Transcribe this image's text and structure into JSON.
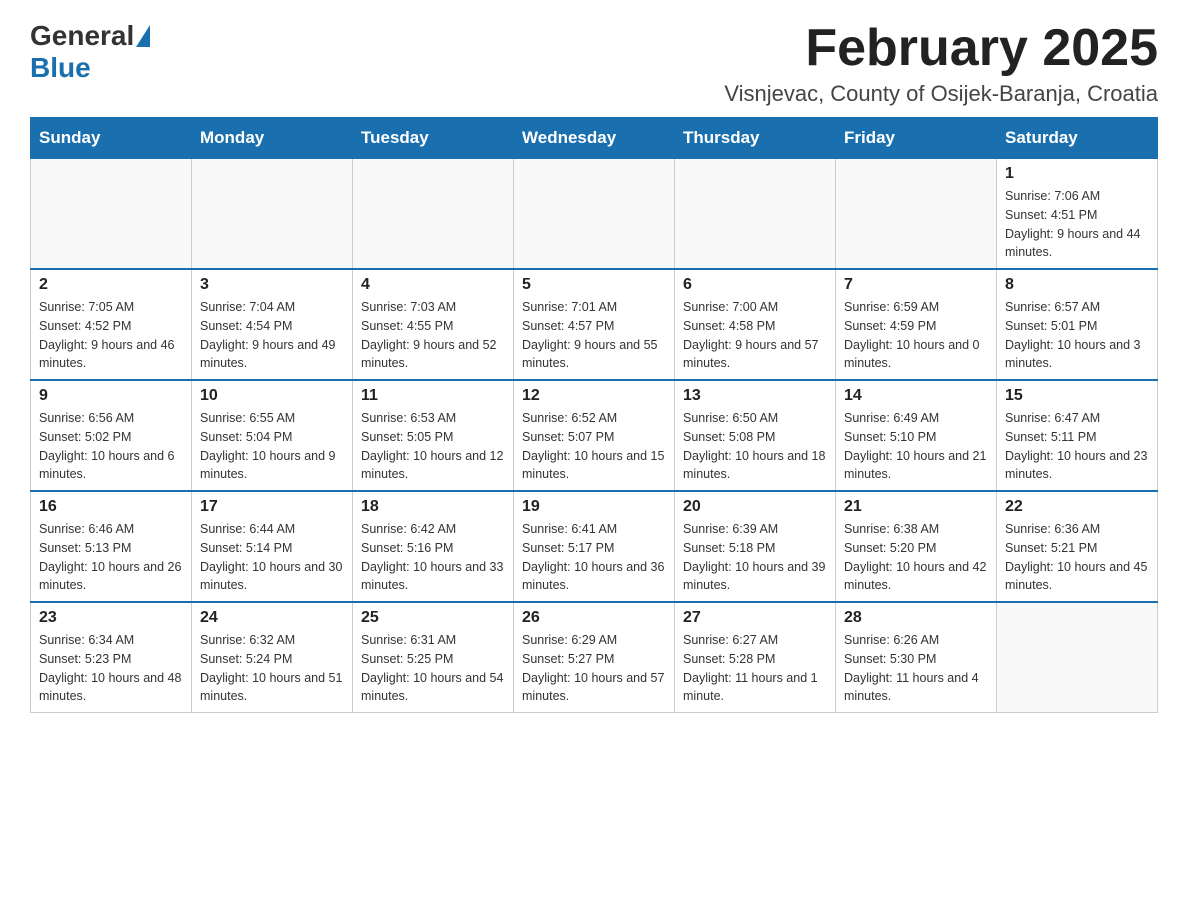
{
  "logo": {
    "text_general": "General",
    "text_blue": "Blue"
  },
  "header": {
    "title": "February 2025",
    "subtitle": "Visnjevac, County of Osijek-Baranja, Croatia"
  },
  "weekdays": [
    "Sunday",
    "Monday",
    "Tuesday",
    "Wednesday",
    "Thursday",
    "Friday",
    "Saturday"
  ],
  "weeks": [
    [
      {
        "day": "",
        "info": ""
      },
      {
        "day": "",
        "info": ""
      },
      {
        "day": "",
        "info": ""
      },
      {
        "day": "",
        "info": ""
      },
      {
        "day": "",
        "info": ""
      },
      {
        "day": "",
        "info": ""
      },
      {
        "day": "1",
        "info": "Sunrise: 7:06 AM\nSunset: 4:51 PM\nDaylight: 9 hours and 44 minutes."
      }
    ],
    [
      {
        "day": "2",
        "info": "Sunrise: 7:05 AM\nSunset: 4:52 PM\nDaylight: 9 hours and 46 minutes."
      },
      {
        "day": "3",
        "info": "Sunrise: 7:04 AM\nSunset: 4:54 PM\nDaylight: 9 hours and 49 minutes."
      },
      {
        "day": "4",
        "info": "Sunrise: 7:03 AM\nSunset: 4:55 PM\nDaylight: 9 hours and 52 minutes."
      },
      {
        "day": "5",
        "info": "Sunrise: 7:01 AM\nSunset: 4:57 PM\nDaylight: 9 hours and 55 minutes."
      },
      {
        "day": "6",
        "info": "Sunrise: 7:00 AM\nSunset: 4:58 PM\nDaylight: 9 hours and 57 minutes."
      },
      {
        "day": "7",
        "info": "Sunrise: 6:59 AM\nSunset: 4:59 PM\nDaylight: 10 hours and 0 minutes."
      },
      {
        "day": "8",
        "info": "Sunrise: 6:57 AM\nSunset: 5:01 PM\nDaylight: 10 hours and 3 minutes."
      }
    ],
    [
      {
        "day": "9",
        "info": "Sunrise: 6:56 AM\nSunset: 5:02 PM\nDaylight: 10 hours and 6 minutes."
      },
      {
        "day": "10",
        "info": "Sunrise: 6:55 AM\nSunset: 5:04 PM\nDaylight: 10 hours and 9 minutes."
      },
      {
        "day": "11",
        "info": "Sunrise: 6:53 AM\nSunset: 5:05 PM\nDaylight: 10 hours and 12 minutes."
      },
      {
        "day": "12",
        "info": "Sunrise: 6:52 AM\nSunset: 5:07 PM\nDaylight: 10 hours and 15 minutes."
      },
      {
        "day": "13",
        "info": "Sunrise: 6:50 AM\nSunset: 5:08 PM\nDaylight: 10 hours and 18 minutes."
      },
      {
        "day": "14",
        "info": "Sunrise: 6:49 AM\nSunset: 5:10 PM\nDaylight: 10 hours and 21 minutes."
      },
      {
        "day": "15",
        "info": "Sunrise: 6:47 AM\nSunset: 5:11 PM\nDaylight: 10 hours and 23 minutes."
      }
    ],
    [
      {
        "day": "16",
        "info": "Sunrise: 6:46 AM\nSunset: 5:13 PM\nDaylight: 10 hours and 26 minutes."
      },
      {
        "day": "17",
        "info": "Sunrise: 6:44 AM\nSunset: 5:14 PM\nDaylight: 10 hours and 30 minutes."
      },
      {
        "day": "18",
        "info": "Sunrise: 6:42 AM\nSunset: 5:16 PM\nDaylight: 10 hours and 33 minutes."
      },
      {
        "day": "19",
        "info": "Sunrise: 6:41 AM\nSunset: 5:17 PM\nDaylight: 10 hours and 36 minutes."
      },
      {
        "day": "20",
        "info": "Sunrise: 6:39 AM\nSunset: 5:18 PM\nDaylight: 10 hours and 39 minutes."
      },
      {
        "day": "21",
        "info": "Sunrise: 6:38 AM\nSunset: 5:20 PM\nDaylight: 10 hours and 42 minutes."
      },
      {
        "day": "22",
        "info": "Sunrise: 6:36 AM\nSunset: 5:21 PM\nDaylight: 10 hours and 45 minutes."
      }
    ],
    [
      {
        "day": "23",
        "info": "Sunrise: 6:34 AM\nSunset: 5:23 PM\nDaylight: 10 hours and 48 minutes."
      },
      {
        "day": "24",
        "info": "Sunrise: 6:32 AM\nSunset: 5:24 PM\nDaylight: 10 hours and 51 minutes."
      },
      {
        "day": "25",
        "info": "Sunrise: 6:31 AM\nSunset: 5:25 PM\nDaylight: 10 hours and 54 minutes."
      },
      {
        "day": "26",
        "info": "Sunrise: 6:29 AM\nSunset: 5:27 PM\nDaylight: 10 hours and 57 minutes."
      },
      {
        "day": "27",
        "info": "Sunrise: 6:27 AM\nSunset: 5:28 PM\nDaylight: 11 hours and 1 minute."
      },
      {
        "day": "28",
        "info": "Sunrise: 6:26 AM\nSunset: 5:30 PM\nDaylight: 11 hours and 4 minutes."
      },
      {
        "day": "",
        "info": ""
      }
    ]
  ]
}
